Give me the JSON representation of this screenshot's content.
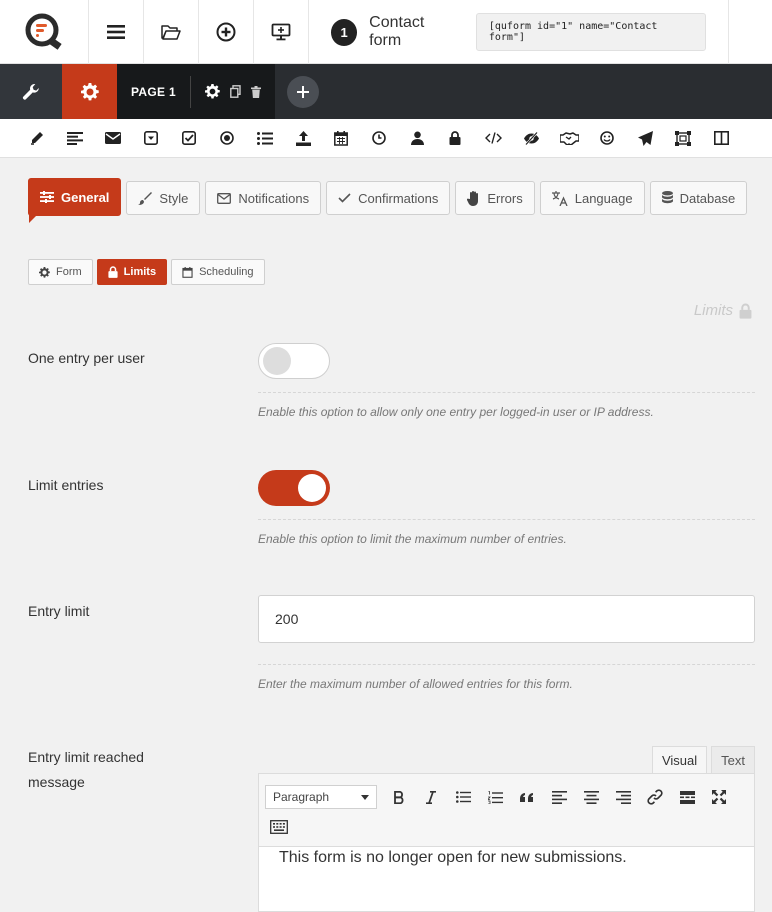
{
  "topbar": {
    "form_number": "1",
    "form_name": "Contact form",
    "shortcode": "[quform id=\"1\" name=\"Contact form\"]"
  },
  "pagebar": {
    "page_label": "PAGE 1"
  },
  "main_tabs": [
    {
      "label": "General",
      "icon": "sliders-icon",
      "active": true
    },
    {
      "label": "Style",
      "icon": "brush-icon",
      "active": false
    },
    {
      "label": "Notifications",
      "icon": "envelope-icon",
      "active": false
    },
    {
      "label": "Confirmations",
      "icon": "check-icon",
      "active": false
    },
    {
      "label": "Errors",
      "icon": "hand-icon",
      "active": false
    },
    {
      "label": "Language",
      "icon": "translate-icon",
      "active": false
    },
    {
      "label": "Database",
      "icon": "database-icon",
      "active": false
    }
  ],
  "sub_tabs": [
    {
      "label": "Form",
      "icon": "gear-icon",
      "active": false
    },
    {
      "label": "Limits",
      "icon": "lock-icon",
      "active": true
    },
    {
      "label": "Scheduling",
      "icon": "calendar-icon",
      "active": false
    }
  ],
  "section": {
    "title": "Limits"
  },
  "settings": {
    "one_entry": {
      "label": "One entry per user",
      "enabled": false,
      "description": "Enable this option to allow only one entry per logged-in user or IP address."
    },
    "limit_entries": {
      "label": "Limit entries",
      "enabled": true,
      "description": "Enable this option to limit the maximum number of entries."
    },
    "entry_limit": {
      "label": "Entry limit",
      "value": "200",
      "description": "Enter the maximum number of allowed entries for this form."
    },
    "limit_message": {
      "label_line1": "Entry limit reached",
      "label_line2": "message",
      "tab_visual": "Visual",
      "tab_text": "Text",
      "format_select": "Paragraph",
      "content": "This form is no longer open for new submissions."
    }
  },
  "colors": {
    "accent": "#c53a1a",
    "dark_bar": "#2a2d31"
  }
}
